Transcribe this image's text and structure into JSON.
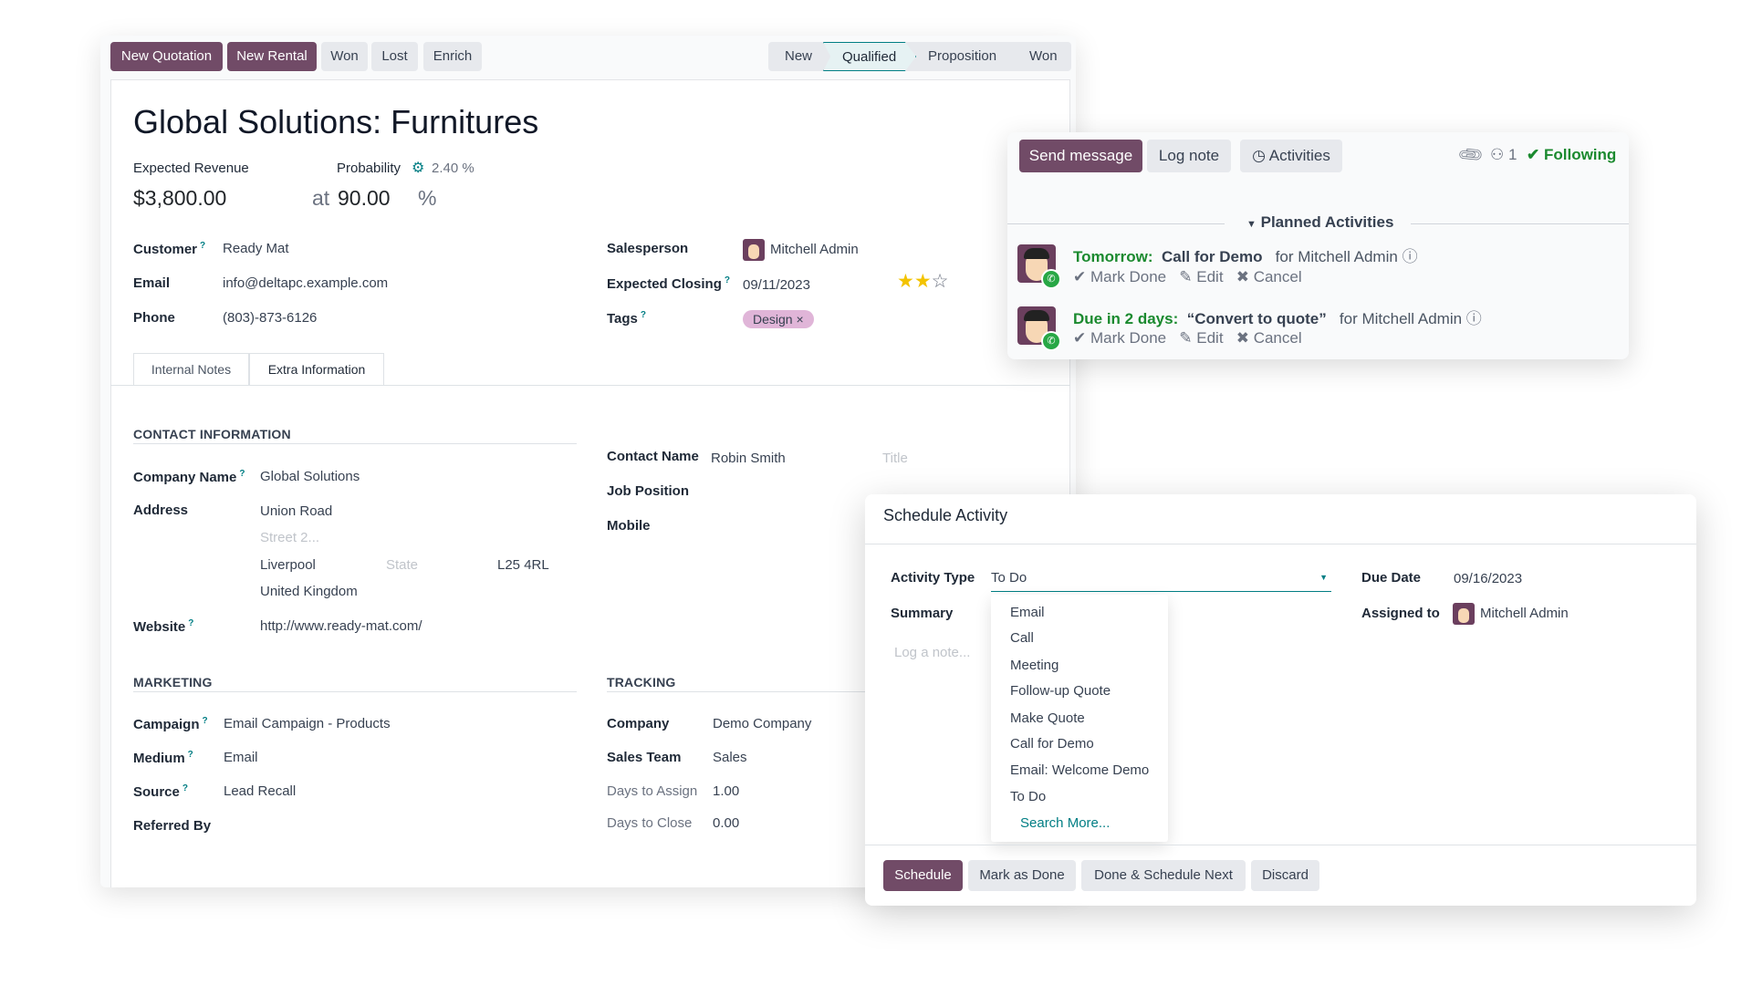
{
  "toolbar": {
    "buttons": [
      "New Quotation",
      "New Rental",
      "Won",
      "Lost",
      "Enrich"
    ]
  },
  "statusbar": {
    "stages": [
      "New",
      "Qualified",
      "Proposition",
      "Won"
    ],
    "active": "Qualified"
  },
  "record": {
    "title": "Global Solutions: Furnitures",
    "expected_revenue_label": "Expected Revenue",
    "expected_revenue": "$3,800.00",
    "probability_label": "Probability",
    "auto_probability": "2.40 %",
    "at": "at",
    "probability": "90.00",
    "percent": "%",
    "customer_label": "Customer",
    "customer": "Ready Mat",
    "email_label": "Email",
    "email": "info@deltapc.example.com",
    "phone_label": "Phone",
    "phone": "(803)-873-6126",
    "salesperson_label": "Salesperson",
    "salesperson": "Mitchell Admin",
    "closing_label": "Expected Closing",
    "closing": "09/11/2023",
    "priority_stars": 2,
    "priority_max": 3,
    "tags_label": "Tags",
    "tag": "Design",
    "tag_color": "#e0b5d8"
  },
  "tabs": [
    "Internal Notes",
    "Extra Information"
  ],
  "extra": {
    "contact_section": "CONTACT INFORMATION",
    "company_name_label": "Company Name",
    "company_name": "Global Solutions",
    "address_label": "Address",
    "street": "Union Road",
    "street2_placeholder": "Street 2...",
    "city": "Liverpool",
    "state_placeholder": "State",
    "zip": "L25 4RL",
    "country": "United Kingdom",
    "website_label": "Website",
    "website": "http://www.ready-mat.com/",
    "contact_name_label": "Contact Name",
    "contact_name": "Robin Smith",
    "title_placeholder": "Title",
    "job_label": "Job Position",
    "mobile_label": "Mobile",
    "marketing_section": "MARKETING",
    "campaign_label": "Campaign",
    "campaign": "Email Campaign - Products",
    "medium_label": "Medium",
    "medium": "Email",
    "source_label": "Source",
    "source": "Lead Recall",
    "referred_label": "Referred By",
    "tracking_section": "TRACKING",
    "company_label": "Company",
    "company": "Demo Company",
    "team_label": "Sales Team",
    "team": "Sales",
    "assign_label": "Days to Assign",
    "assign": "1.00",
    "close_label": "Days to Close",
    "close": "0.00"
  },
  "chatter": {
    "send_message": "Send message",
    "log_note": "Log note",
    "activities": "Activities",
    "followers": "1",
    "following": "Following",
    "planned": "Planned Activities",
    "items": [
      {
        "when": "Tomorrow:",
        "name": "Call for Demo",
        "for": "for Mitchell Admin"
      },
      {
        "when": "Due in 2 days:",
        "name": "“Convert to quote”",
        "for": "for Mitchell Admin"
      }
    ],
    "mark_done": "Mark Done",
    "edit": "Edit",
    "cancel": "Cancel"
  },
  "dialog": {
    "title": "Schedule Activity",
    "activity_type_label": "Activity Type",
    "activity_type": "To Do",
    "summary_label": "Summary",
    "note_placeholder": "Log a note...",
    "due_label": "Due Date",
    "due": "09/16/2023",
    "assigned_label": "Assigned to",
    "assigned": "Mitchell Admin",
    "options": [
      "Email",
      "Call",
      "Meeting",
      "Follow-up Quote",
      "Make Quote",
      "Call for Demo",
      "Email: Welcome Demo",
      "To Do"
    ],
    "search_more": "Search More...",
    "buttons": [
      "Schedule",
      "Mark as Done",
      "Done & Schedule Next",
      "Discard"
    ]
  },
  "colors": {
    "primary": "#714b67",
    "accent": "#017e84",
    "success": "#1b8a2f"
  }
}
